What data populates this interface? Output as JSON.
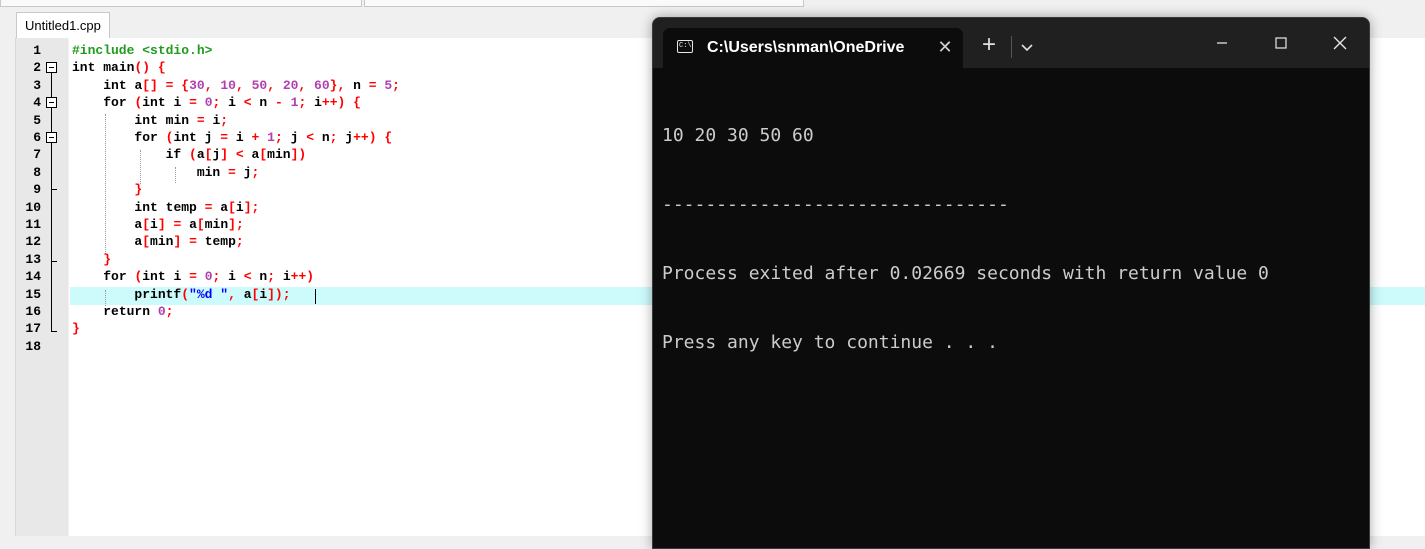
{
  "editor": {
    "file_tab": "Untitled1.cpp",
    "line_numbers": [
      "1",
      "2",
      "3",
      "4",
      "5",
      "6",
      "7",
      "8",
      "9",
      "10",
      "11",
      "12",
      "13",
      "14",
      "15",
      "16",
      "17",
      "18"
    ]
  },
  "terminal": {
    "tab_title": "C:\\Users\\snman\\OneDrive",
    "output_lines": [
      "10 20 30 50 60",
      "--------------------------------",
      "Process exited after 0.02669 seconds with return value 0",
      "Press any key to continue . . ."
    ]
  }
}
